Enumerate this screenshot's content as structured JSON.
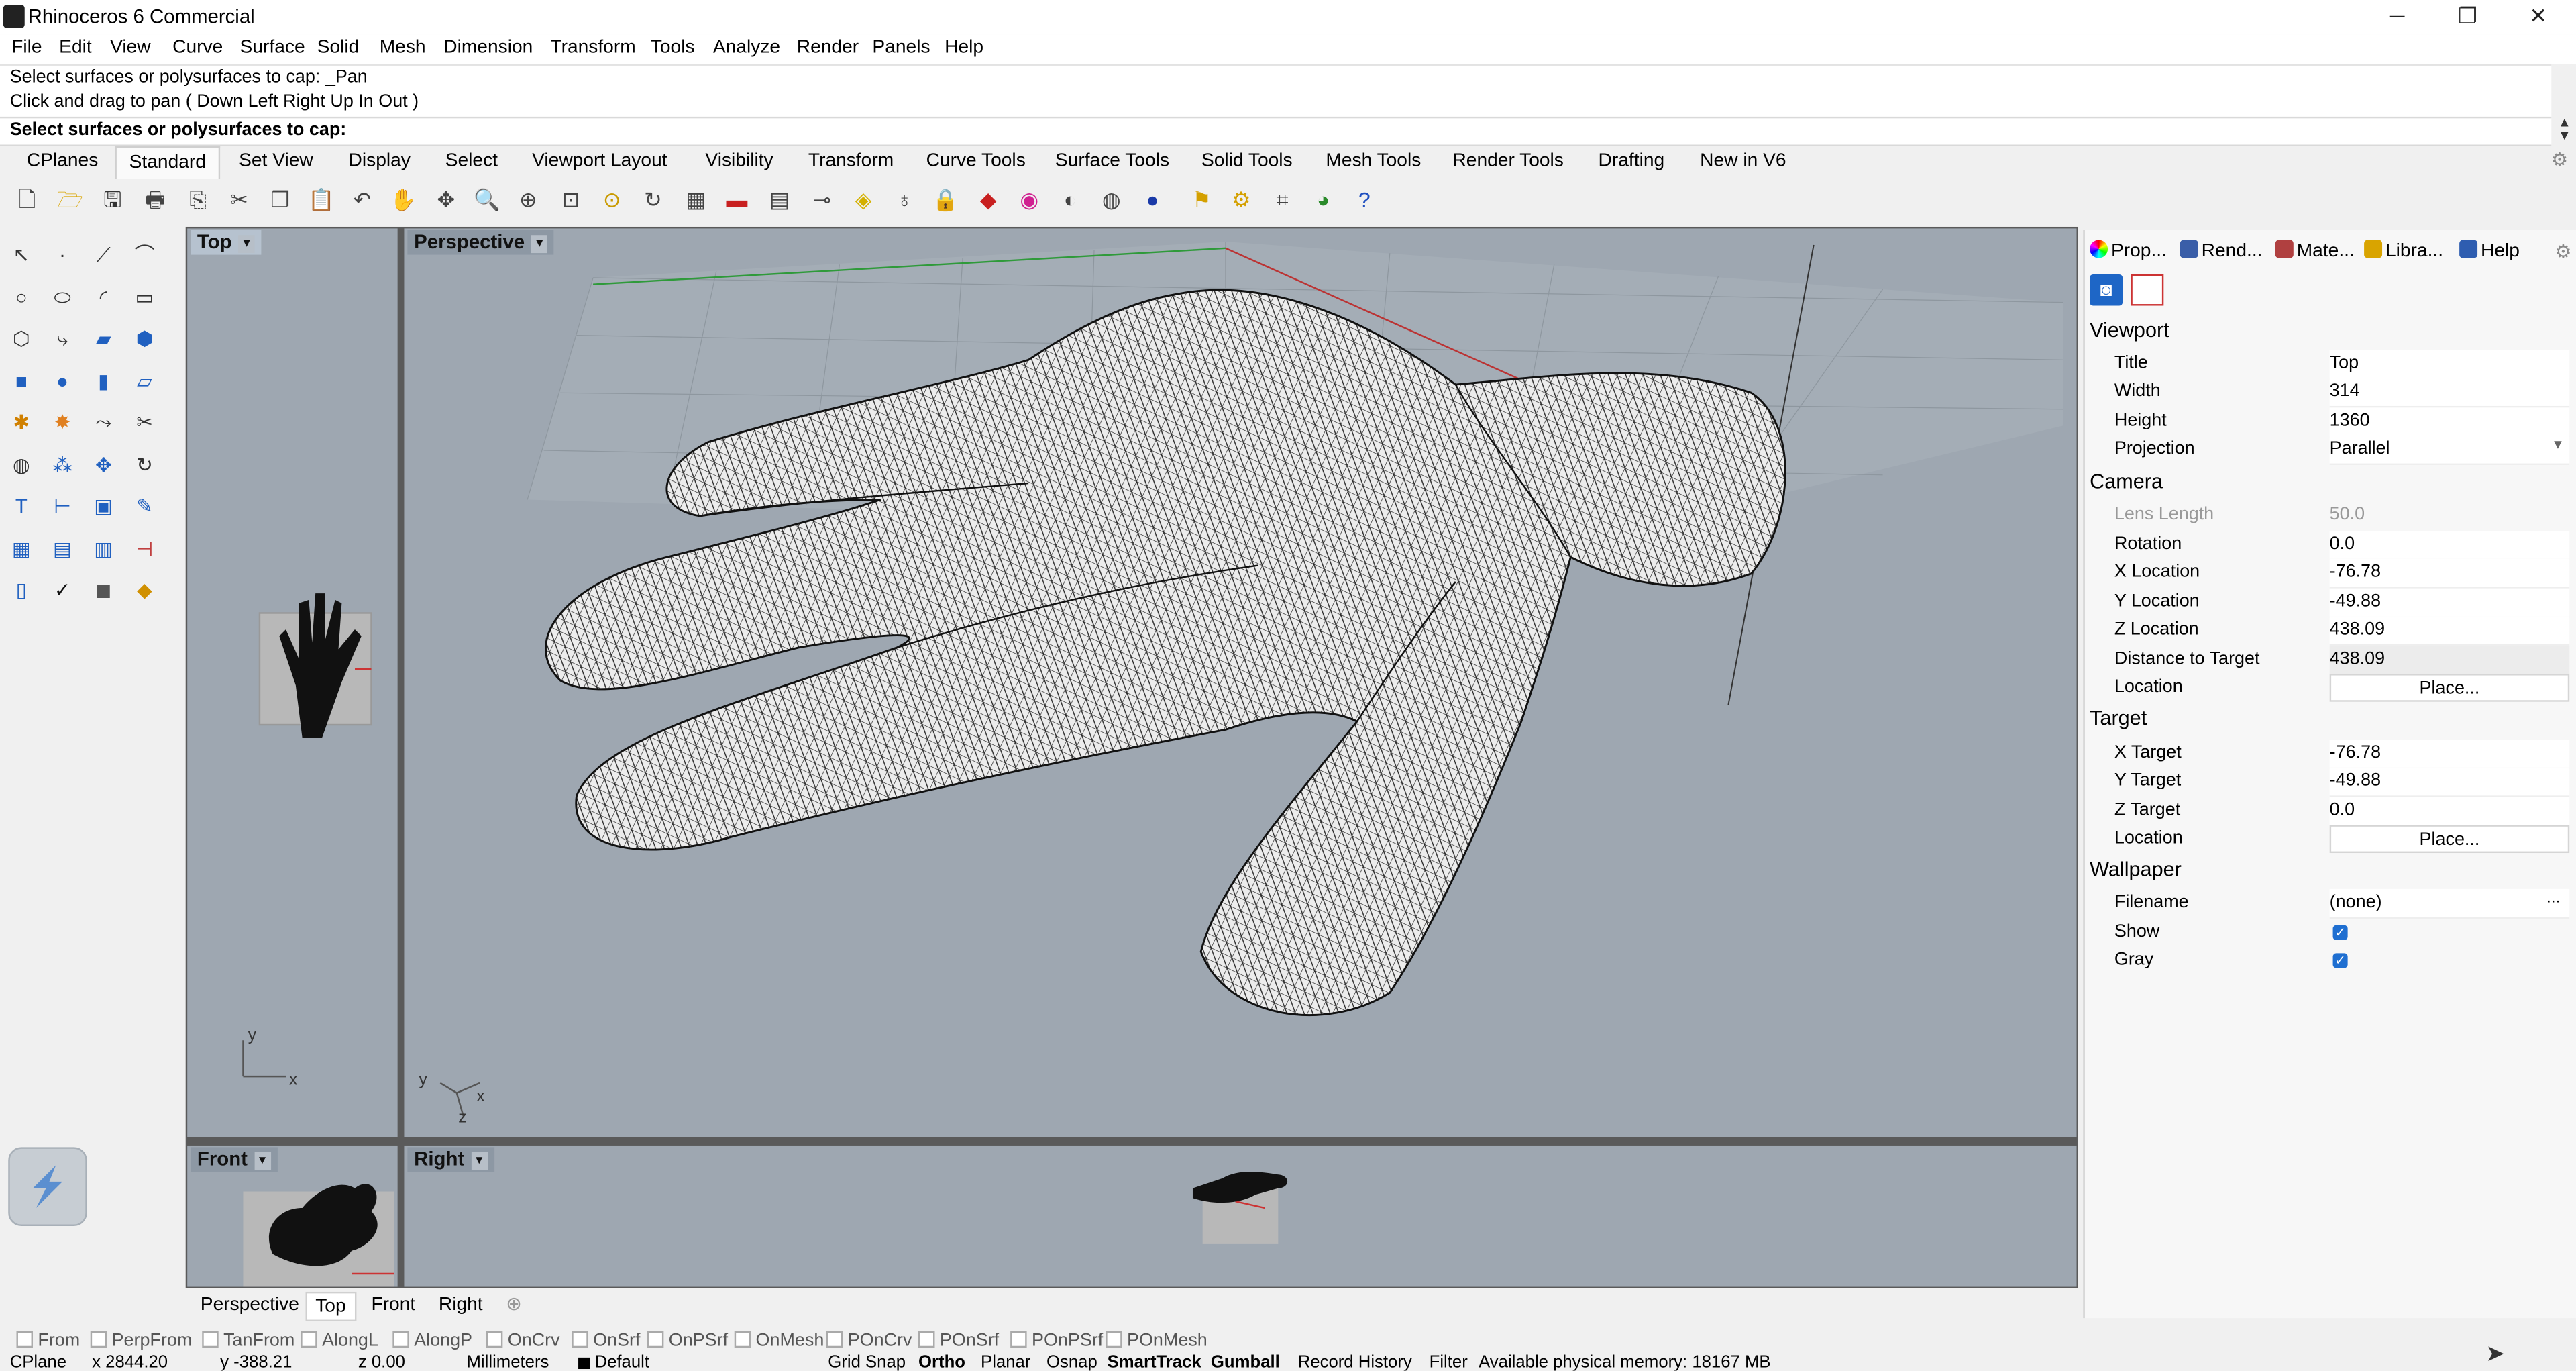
{
  "window": {
    "title": "Rhinoceros 6 Commercial",
    "controls": [
      "─",
      "❐",
      "✕"
    ]
  },
  "menu": [
    "File",
    "Edit",
    "View",
    "Curve",
    "Surface",
    "Solid",
    "Mesh",
    "Dimension",
    "Transform",
    "Tools",
    "Analyze",
    "Render",
    "Panels",
    "Help"
  ],
  "command": {
    "history": [
      "Select surfaces or polysurfaces to cap: _Pan",
      "Click and drag to pan ( Down  Left  Right  Up  In  Out )"
    ],
    "prompt": "Select surfaces or polysurfaces to cap:"
  },
  "toolbar_tabs": [
    "CPlanes",
    "Standard",
    "Set View",
    "Display",
    "Select",
    "Viewport Layout",
    "Visibility",
    "Transform",
    "Curve Tools",
    "Surface Tools",
    "Solid Tools",
    "Mesh Tools",
    "Render Tools",
    "Drafting",
    "New in V6"
  ],
  "active_toolbar_tab": "Standard",
  "toolbar_icons": [
    "new-icon",
    "open-icon",
    "save-icon",
    "print-icon",
    "import-icon",
    "cut-icon",
    "copy-icon",
    "paste-icon",
    "undo-icon",
    "pan-hand-icon",
    "rotate-view-icon",
    "zoom-icon",
    "zoom-window-icon",
    "zoom-extents-icon",
    "zoom-selected-icon",
    "rotate-icon",
    "four-viewports-icon",
    "car-icon",
    "grid-icon",
    "light-icon",
    "bulb-icon",
    "lock-icon",
    "layers-icon",
    "color-wheel-icon",
    "wireframe-sphere-icon",
    "shaded-sphere-icon",
    "rendered-sphere-icon",
    "attributes-icon",
    "options-icon",
    "snap-icon",
    "render-icon",
    "help-icon"
  ],
  "viewports": {
    "top": {
      "label": "Top"
    },
    "perspective": {
      "label": "Perspective"
    },
    "front": {
      "label": "Front"
    },
    "right": {
      "label": "Right"
    }
  },
  "axes": {
    "x": "x",
    "y": "y",
    "z": "z"
  },
  "viewport_tabs": [
    "Perspective",
    "Top",
    "Front",
    "Right"
  ],
  "active_viewport_tab": "Top",
  "panel": {
    "tabs": [
      "Prop...",
      "Rend...",
      "Mate...",
      "Libra...",
      "Help"
    ],
    "sections": {
      "viewport": "Viewport",
      "camera": "Camera",
      "target": "Target",
      "wallpaper": "Wallpaper"
    },
    "viewport_rows": [
      {
        "k": "Title",
        "v": "Top"
      },
      {
        "k": "Width",
        "v": "314"
      },
      {
        "k": "Height",
        "v": "1360"
      },
      {
        "k": "Projection",
        "v": "Parallel"
      }
    ],
    "camera_rows": [
      {
        "k": "Lens Length",
        "v": "50.0"
      },
      {
        "k": "Rotation",
        "v": "0.0"
      },
      {
        "k": "X Location",
        "v": "-76.78"
      },
      {
        "k": "Y Location",
        "v": "-49.88"
      },
      {
        "k": "Z Location",
        "v": "438.09"
      },
      {
        "k": "Distance to Target",
        "v": "438.09"
      },
      {
        "k": "Location",
        "v": "Place..."
      }
    ],
    "target_rows": [
      {
        "k": "X Target",
        "v": "-76.78"
      },
      {
        "k": "Y Target",
        "v": "-49.88"
      },
      {
        "k": "Z Target",
        "v": "0.0"
      },
      {
        "k": "Location",
        "v": "Place..."
      }
    ],
    "wallpaper_rows": [
      {
        "k": "Filename",
        "v": "(none)"
      },
      {
        "k": "Show",
        "v": true
      },
      {
        "k": "Gray",
        "v": true
      }
    ],
    "more": "..."
  },
  "osnaps": [
    "From",
    "PerpFrom",
    "TanFrom",
    "AlongL",
    "AlongP",
    "OnCrv",
    "OnSrf",
    "OnPSrf",
    "OnMesh",
    "POnCrv",
    "POnSrf",
    "POnPSrf",
    "POnMesh"
  ],
  "status": {
    "cplane": "CPlane",
    "x": "x 2844.20",
    "y": "y -388.21",
    "z": "z 0.00",
    "units": "Millimeters",
    "layer": "Default",
    "grid_snap": "Grid Snap",
    "ortho": "Ortho",
    "planar": "Planar",
    "osnap": "Osnap",
    "smarttrack": "SmartTrack",
    "gumball": "Gumball",
    "record_history": "Record History",
    "filter": "Filter",
    "memory": "Available physical memory: 18167 MB"
  }
}
